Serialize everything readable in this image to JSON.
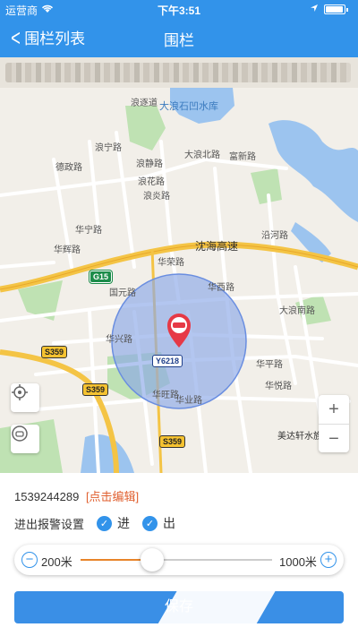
{
  "status": {
    "carrier": "运营商",
    "time": "下午3:51"
  },
  "nav": {
    "back_label": "围栏列表",
    "title": "围栏"
  },
  "map": {
    "labels": {
      "langjiao": "浪逐道",
      "reservoir": "大浪石凹水库",
      "dehui": "德政路",
      "langning": "浪宁路",
      "langjing": "浪静路",
      "langhua": "浪花路",
      "langyan": "浪炎路",
      "huaning": "华宁路",
      "huarong": "华荣路",
      "huahui": "华辉路",
      "guoyuan": "国元路",
      "huaxing": "华兴路",
      "huawang": "华旺路",
      "huaxi": "华西路",
      "huaye": "华业路",
      "huaping": "华平路",
      "huayue": "华悦路",
      "dalang_s": "大浪南路",
      "dalang_n": "大浪北路",
      "fuxin": "富新路",
      "yanhe": "沿河路",
      "shenhai": "沈海高速",
      "meida": "美达轩水族",
      "g15": "G15",
      "s359a": "S359",
      "s359b": "S359",
      "s359c": "S359",
      "y6218": "Y6218"
    }
  },
  "fence": {
    "id": "1539244289",
    "edit_label": "[点击编辑]"
  },
  "alarm": {
    "label": "进出报警设置",
    "in_label": "进",
    "out_label": "出",
    "in_checked": true,
    "out_checked": true
  },
  "radius": {
    "min_label": "200米",
    "max_label": "1000米",
    "min": 200,
    "max": 1000,
    "value": 500
  },
  "save_button": {
    "label": "保存"
  },
  "colors": {
    "primary": "#3293ea",
    "accent": "#e8842a",
    "edit": "#e06030",
    "fence_fill": "#8aa8e8"
  }
}
